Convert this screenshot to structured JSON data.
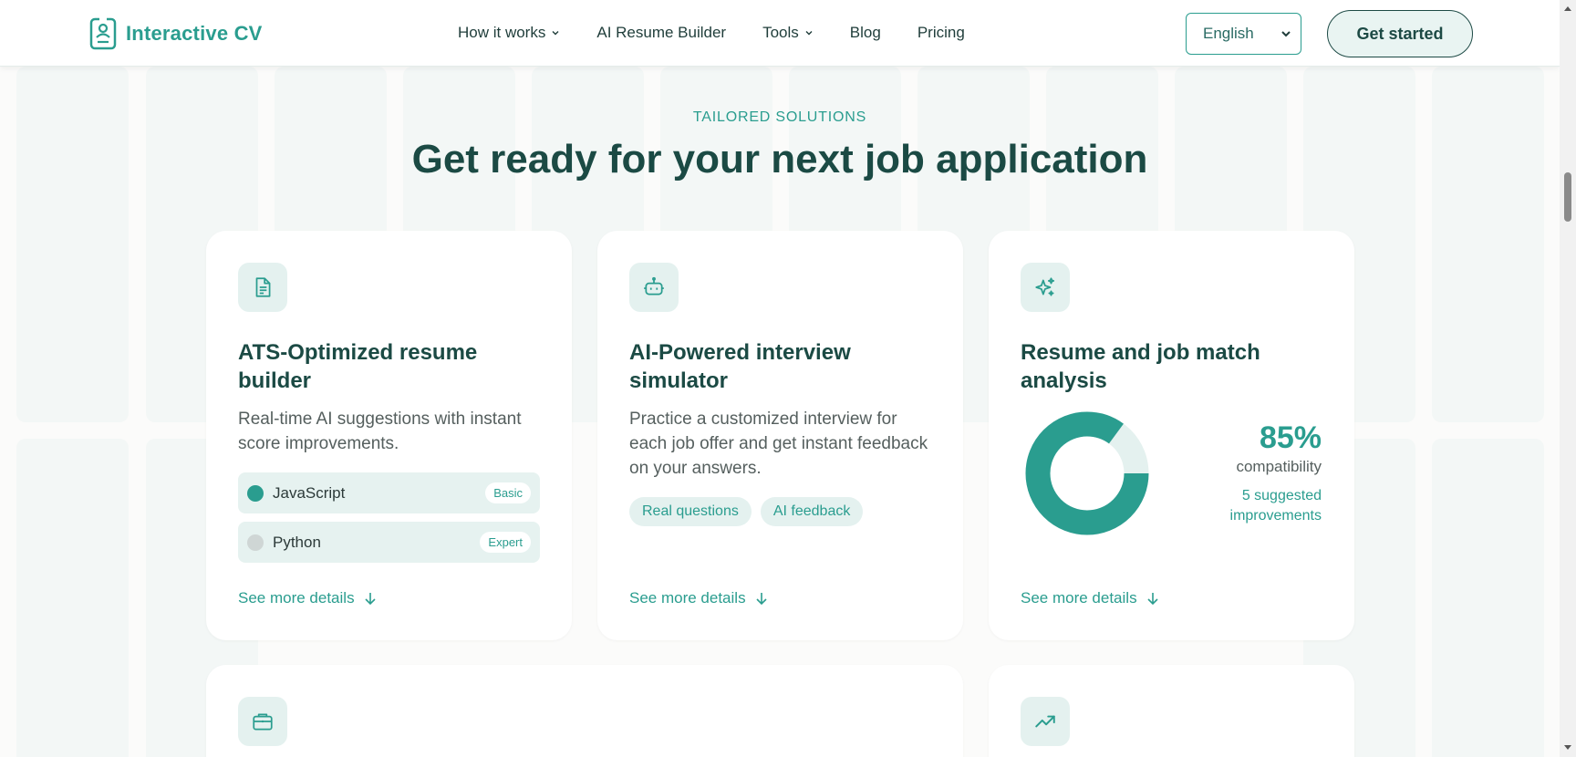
{
  "header": {
    "logo_text": "Interactive CV",
    "logo_icon": "id-badge-icon",
    "nav": [
      {
        "label": "How it works",
        "has_dropdown": true
      },
      {
        "label": "AI Resume Builder",
        "has_dropdown": false
      },
      {
        "label": "Tools",
        "has_dropdown": true
      },
      {
        "label": "Blog",
        "has_dropdown": false
      },
      {
        "label": "Pricing",
        "has_dropdown": false
      }
    ],
    "language_select": {
      "value": "English"
    },
    "cta_label": "Get started"
  },
  "section": {
    "eyebrow": "TAILORED SOLUTIONS",
    "title": "Get ready for your next job application"
  },
  "cards": [
    {
      "icon": "document-icon",
      "title": "ATS-Optimized resume builder",
      "description": "Real-time AI suggestions with instant score improvements.",
      "skills": [
        {
          "name": "JavaScript",
          "level": "Basic",
          "active": true
        },
        {
          "name": "Python",
          "level": "Expert",
          "active": false
        }
      ],
      "link": "See more details"
    },
    {
      "icon": "robot-icon",
      "title": "AI-Powered interview simulator",
      "description": "Practice a customized interview for each job offer and get instant feedback on your answers.",
      "tags": [
        "Real questions",
        "AI feedback"
      ],
      "link": "See more details"
    },
    {
      "icon": "sparkles-icon",
      "title": "Resume and job match analysis",
      "match_percent": 85,
      "match_label": "85%",
      "match_caption": "compatibility",
      "improvements": "5 suggested improvements",
      "link": "See more details"
    }
  ],
  "bottom_cards": [
    {
      "icon": "briefcase-icon"
    },
    {
      "icon": "trending-up-icon"
    }
  ],
  "colors": {
    "accent": "#2a9d8f",
    "heading": "#1b4a44",
    "tint": "#e4f1ef"
  }
}
